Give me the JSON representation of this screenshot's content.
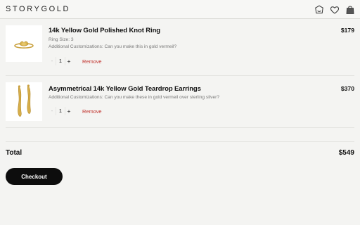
{
  "header": {
    "logo": "STORYGOLD",
    "icons": [
      "account-icon",
      "heart-icon",
      "bag-icon"
    ]
  },
  "items": [
    {
      "name": "14k Yellow Gold Polished Knot Ring",
      "options": [
        "Ring Size: 3",
        "Additional Customizations: Can you make this in gold vermeil?"
      ],
      "quantity": "1",
      "price": "$179",
      "minus": "-",
      "plus": "+",
      "remove": "Remove"
    },
    {
      "name": "Asymmetrical 14k Yellow Gold Teardrop Earrings",
      "options": [
        "Additional Customizations: Can you make these in gold vermeil over sterling silver?"
      ],
      "quantity": "1",
      "price": "$370",
      "minus": "-",
      "plus": "+",
      "remove": "Remove"
    }
  ],
  "summary": {
    "total_label": "Total",
    "total_value": "$549",
    "checkout_label": "Checkout"
  },
  "colors": {
    "remove": "#c0312b",
    "button": "#0d0d0d",
    "background": "#f4f4f2"
  }
}
